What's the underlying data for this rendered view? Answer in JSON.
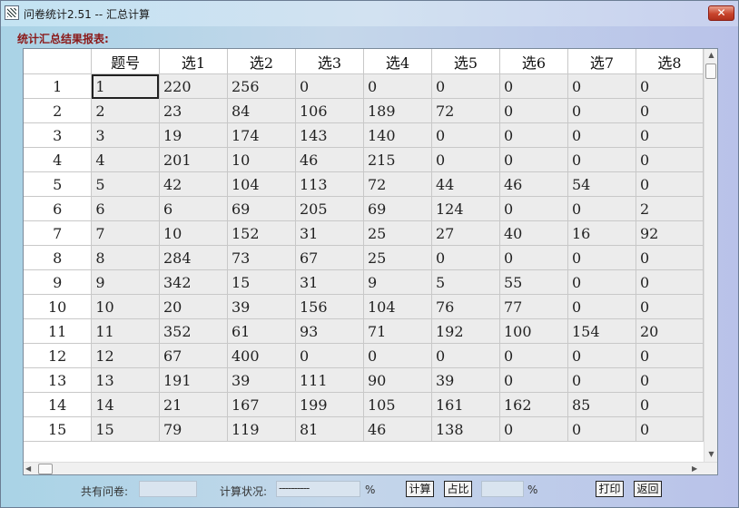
{
  "window": {
    "title": "问卷统计2.51 -- 汇总计算",
    "close_icon": "close-icon"
  },
  "report_label": "统计汇总结果报表:",
  "table": {
    "headers": [
      "",
      "题号",
      "选1",
      "选2",
      "选3",
      "选4",
      "选5",
      "选6",
      "选7",
      "选8"
    ],
    "rows": [
      [
        "1",
        "1",
        "220",
        "256",
        "0",
        "0",
        "0",
        "0",
        "0",
        "0"
      ],
      [
        "2",
        "2",
        "23",
        "84",
        "106",
        "189",
        "72",
        "0",
        "0",
        "0"
      ],
      [
        "3",
        "3",
        "19",
        "174",
        "143",
        "140",
        "0",
        "0",
        "0",
        "0"
      ],
      [
        "4",
        "4",
        "201",
        "10",
        "46",
        "215",
        "0",
        "0",
        "0",
        "0"
      ],
      [
        "5",
        "5",
        "42",
        "104",
        "113",
        "72",
        "44",
        "46",
        "54",
        "0"
      ],
      [
        "6",
        "6",
        "6",
        "69",
        "205",
        "69",
        "124",
        "0",
        "0",
        "2"
      ],
      [
        "7",
        "7",
        "10",
        "152",
        "31",
        "25",
        "27",
        "40",
        "16",
        "92"
      ],
      [
        "8",
        "8",
        "284",
        "73",
        "67",
        "25",
        "0",
        "0",
        "0",
        "0"
      ],
      [
        "9",
        "9",
        "342",
        "15",
        "31",
        "9",
        "5",
        "55",
        "0",
        "0"
      ],
      [
        "10",
        "10",
        "20",
        "39",
        "156",
        "104",
        "76",
        "77",
        "0",
        "0"
      ],
      [
        "11",
        "11",
        "352",
        "61",
        "93",
        "71",
        "192",
        "100",
        "154",
        "20"
      ],
      [
        "12",
        "12",
        "67",
        "400",
        "0",
        "0",
        "0",
        "0",
        "0",
        "0"
      ],
      [
        "13",
        "13",
        "191",
        "39",
        "111",
        "90",
        "39",
        "0",
        "0",
        "0"
      ],
      [
        "14",
        "14",
        "21",
        "167",
        "199",
        "105",
        "161",
        "162",
        "85",
        "0"
      ],
      [
        "15",
        "15",
        "79",
        "119",
        "81",
        "46",
        "138",
        "0",
        "0",
        "0"
      ]
    ]
  },
  "footer": {
    "total_label": "共有问卷:",
    "total_value": "",
    "status_label": "计算状况:",
    "status_value": "----------",
    "percent_sign_1": "%",
    "calc_button": "计算",
    "share_button": "占比",
    "share_value": "",
    "percent_sign_2": "%",
    "print_button": "打印",
    "back_button": "返回"
  },
  "colors": {
    "report_label": "#8b1a1a",
    "close_button": "#c9452c",
    "cell_bg": "#ececec"
  }
}
